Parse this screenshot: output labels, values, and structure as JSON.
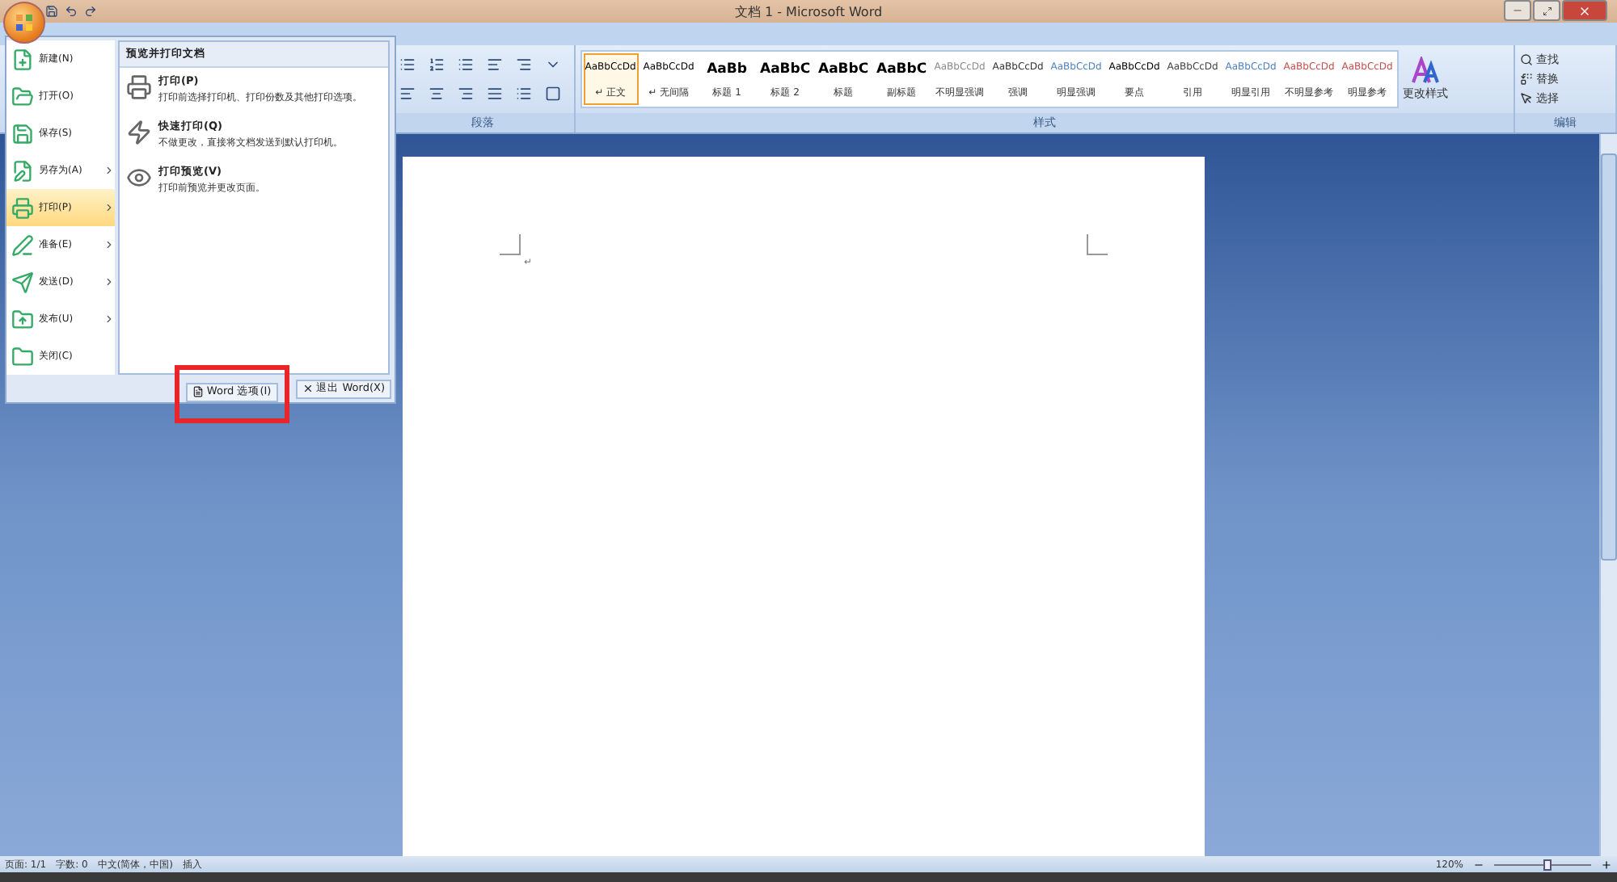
{
  "window": {
    "title": "文档 1 - Microsoft Word"
  },
  "ribbon": {
    "groups": [
      {
        "label": "段落"
      },
      {
        "label": "样式"
      },
      {
        "label": "编辑"
      }
    ],
    "styles": [
      {
        "sample": "AaBbCcDd",
        "label": "↵ 正文",
        "kind": "body",
        "color": "#000000",
        "selected": true
      },
      {
        "sample": "AaBbCcDd",
        "label": "↵ 无间隔",
        "kind": "body",
        "color": "#000000",
        "selected": false
      },
      {
        "sample": "AaBb",
        "label": "标题 1",
        "kind": "heading",
        "color": "#000000",
        "selected": false
      },
      {
        "sample": "AaBbC",
        "label": "标题 2",
        "kind": "heading",
        "color": "#000000",
        "selected": false
      },
      {
        "sample": "AaBbC",
        "label": "标题",
        "kind": "heading",
        "color": "#000000",
        "selected": false
      },
      {
        "sample": "AaBbC",
        "label": "副标题",
        "kind": "heading",
        "color": "#000000",
        "selected": false
      },
      {
        "sample": "AaBbCcDd",
        "label": "不明显强调",
        "kind": "body",
        "color": "#8a8a8a",
        "selected": false
      },
      {
        "sample": "AaBbCcDd",
        "label": "强调",
        "kind": "body",
        "color": "#333333",
        "selected": false
      },
      {
        "sample": "AaBbCcDd",
        "label": "明显强调",
        "kind": "body",
        "color": "#4f81bd",
        "selected": false
      },
      {
        "sample": "AaBbCcDd",
        "label": "要点",
        "kind": "body",
        "color": "#000000",
        "selected": false
      },
      {
        "sample": "AaBbCcDd",
        "label": "引用",
        "kind": "body",
        "color": "#444444",
        "selected": false
      },
      {
        "sample": "AaBbCcDd",
        "label": "明显引用",
        "kind": "body",
        "color": "#4f81bd",
        "selected": false
      },
      {
        "sample": "AaBbCcDd",
        "label": "不明显参考",
        "kind": "body",
        "color": "#c0504d",
        "selected": false
      },
      {
        "sample": "AaBbCcDd",
        "label": "明显参考",
        "kind": "body",
        "color": "#c0504d",
        "selected": false
      }
    ],
    "change_styles": "更改样式",
    "editing": [
      {
        "label": "查找"
      },
      {
        "label": "替换"
      },
      {
        "label": "选择"
      }
    ]
  },
  "office_menu": {
    "items": [
      {
        "label": "新建(N)",
        "submenu": false,
        "selected": false
      },
      {
        "label": "打开(O)",
        "submenu": false,
        "selected": false
      },
      {
        "label": "保存(S)",
        "submenu": false,
        "selected": false
      },
      {
        "label": "另存为(A)",
        "submenu": true,
        "selected": false
      },
      {
        "label": "打印(P)",
        "submenu": true,
        "selected": true
      },
      {
        "label": "准备(E)",
        "submenu": true,
        "selected": false
      },
      {
        "label": "发送(D)",
        "submenu": true,
        "selected": false
      },
      {
        "label": "发布(U)",
        "submenu": true,
        "selected": false
      },
      {
        "label": "关闭(C)",
        "submenu": false,
        "selected": false
      }
    ],
    "panel_title": "预览并打印文档",
    "entries": [
      {
        "title": "打印(P)",
        "description": "打印前选择打印机、打印份数及其他打印选项。"
      },
      {
        "title": "快速打印(Q)",
        "description": "不做更改，直接将文档发送到默认打印机。"
      },
      {
        "title": "打印预览(V)",
        "description": "打印前预览并更改页面。"
      }
    ],
    "buttons": [
      {
        "label": "Word 选项(I)",
        "highlighted": true
      },
      {
        "label": "退出 Word(X)",
        "highlighted": false
      }
    ]
  },
  "document": {
    "paragraph_mark": "↵"
  },
  "status_bar": {
    "items": [
      "页面: 1/1",
      "字数: 0",
      "中文(简体，中国)",
      "插入"
    ],
    "zoom": "120%",
    "zoom_level": {
      "level": 0.55
    }
  }
}
